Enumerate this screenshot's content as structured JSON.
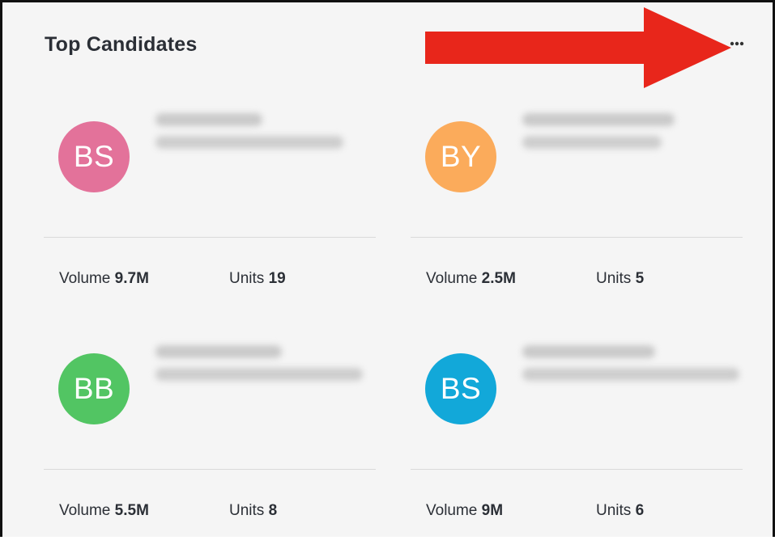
{
  "widget": {
    "title": "Top Candidates",
    "more_label": "…",
    "candidates": [
      {
        "initials": "BS",
        "avatar_color": "#e3729a",
        "volume_label": "Volume",
        "volume_value": "9.7M",
        "units_label": "Units",
        "units_value": "19"
      },
      {
        "initials": "BY",
        "avatar_color": "#fbab5b",
        "volume_label": "Volume",
        "volume_value": "2.5M",
        "units_label": "Units",
        "units_value": "5"
      },
      {
        "initials": "BB",
        "avatar_color": "#52c563",
        "volume_label": "Volume",
        "volume_value": "5.5M",
        "units_label": "Units",
        "units_value": "8"
      },
      {
        "initials": "BS",
        "avatar_color": "#12a8d9",
        "volume_label": "Volume",
        "volume_value": "9M",
        "units_label": "Units",
        "units_value": "6"
      }
    ]
  },
  "annotation": {
    "arrow_color": "#e8261b"
  }
}
